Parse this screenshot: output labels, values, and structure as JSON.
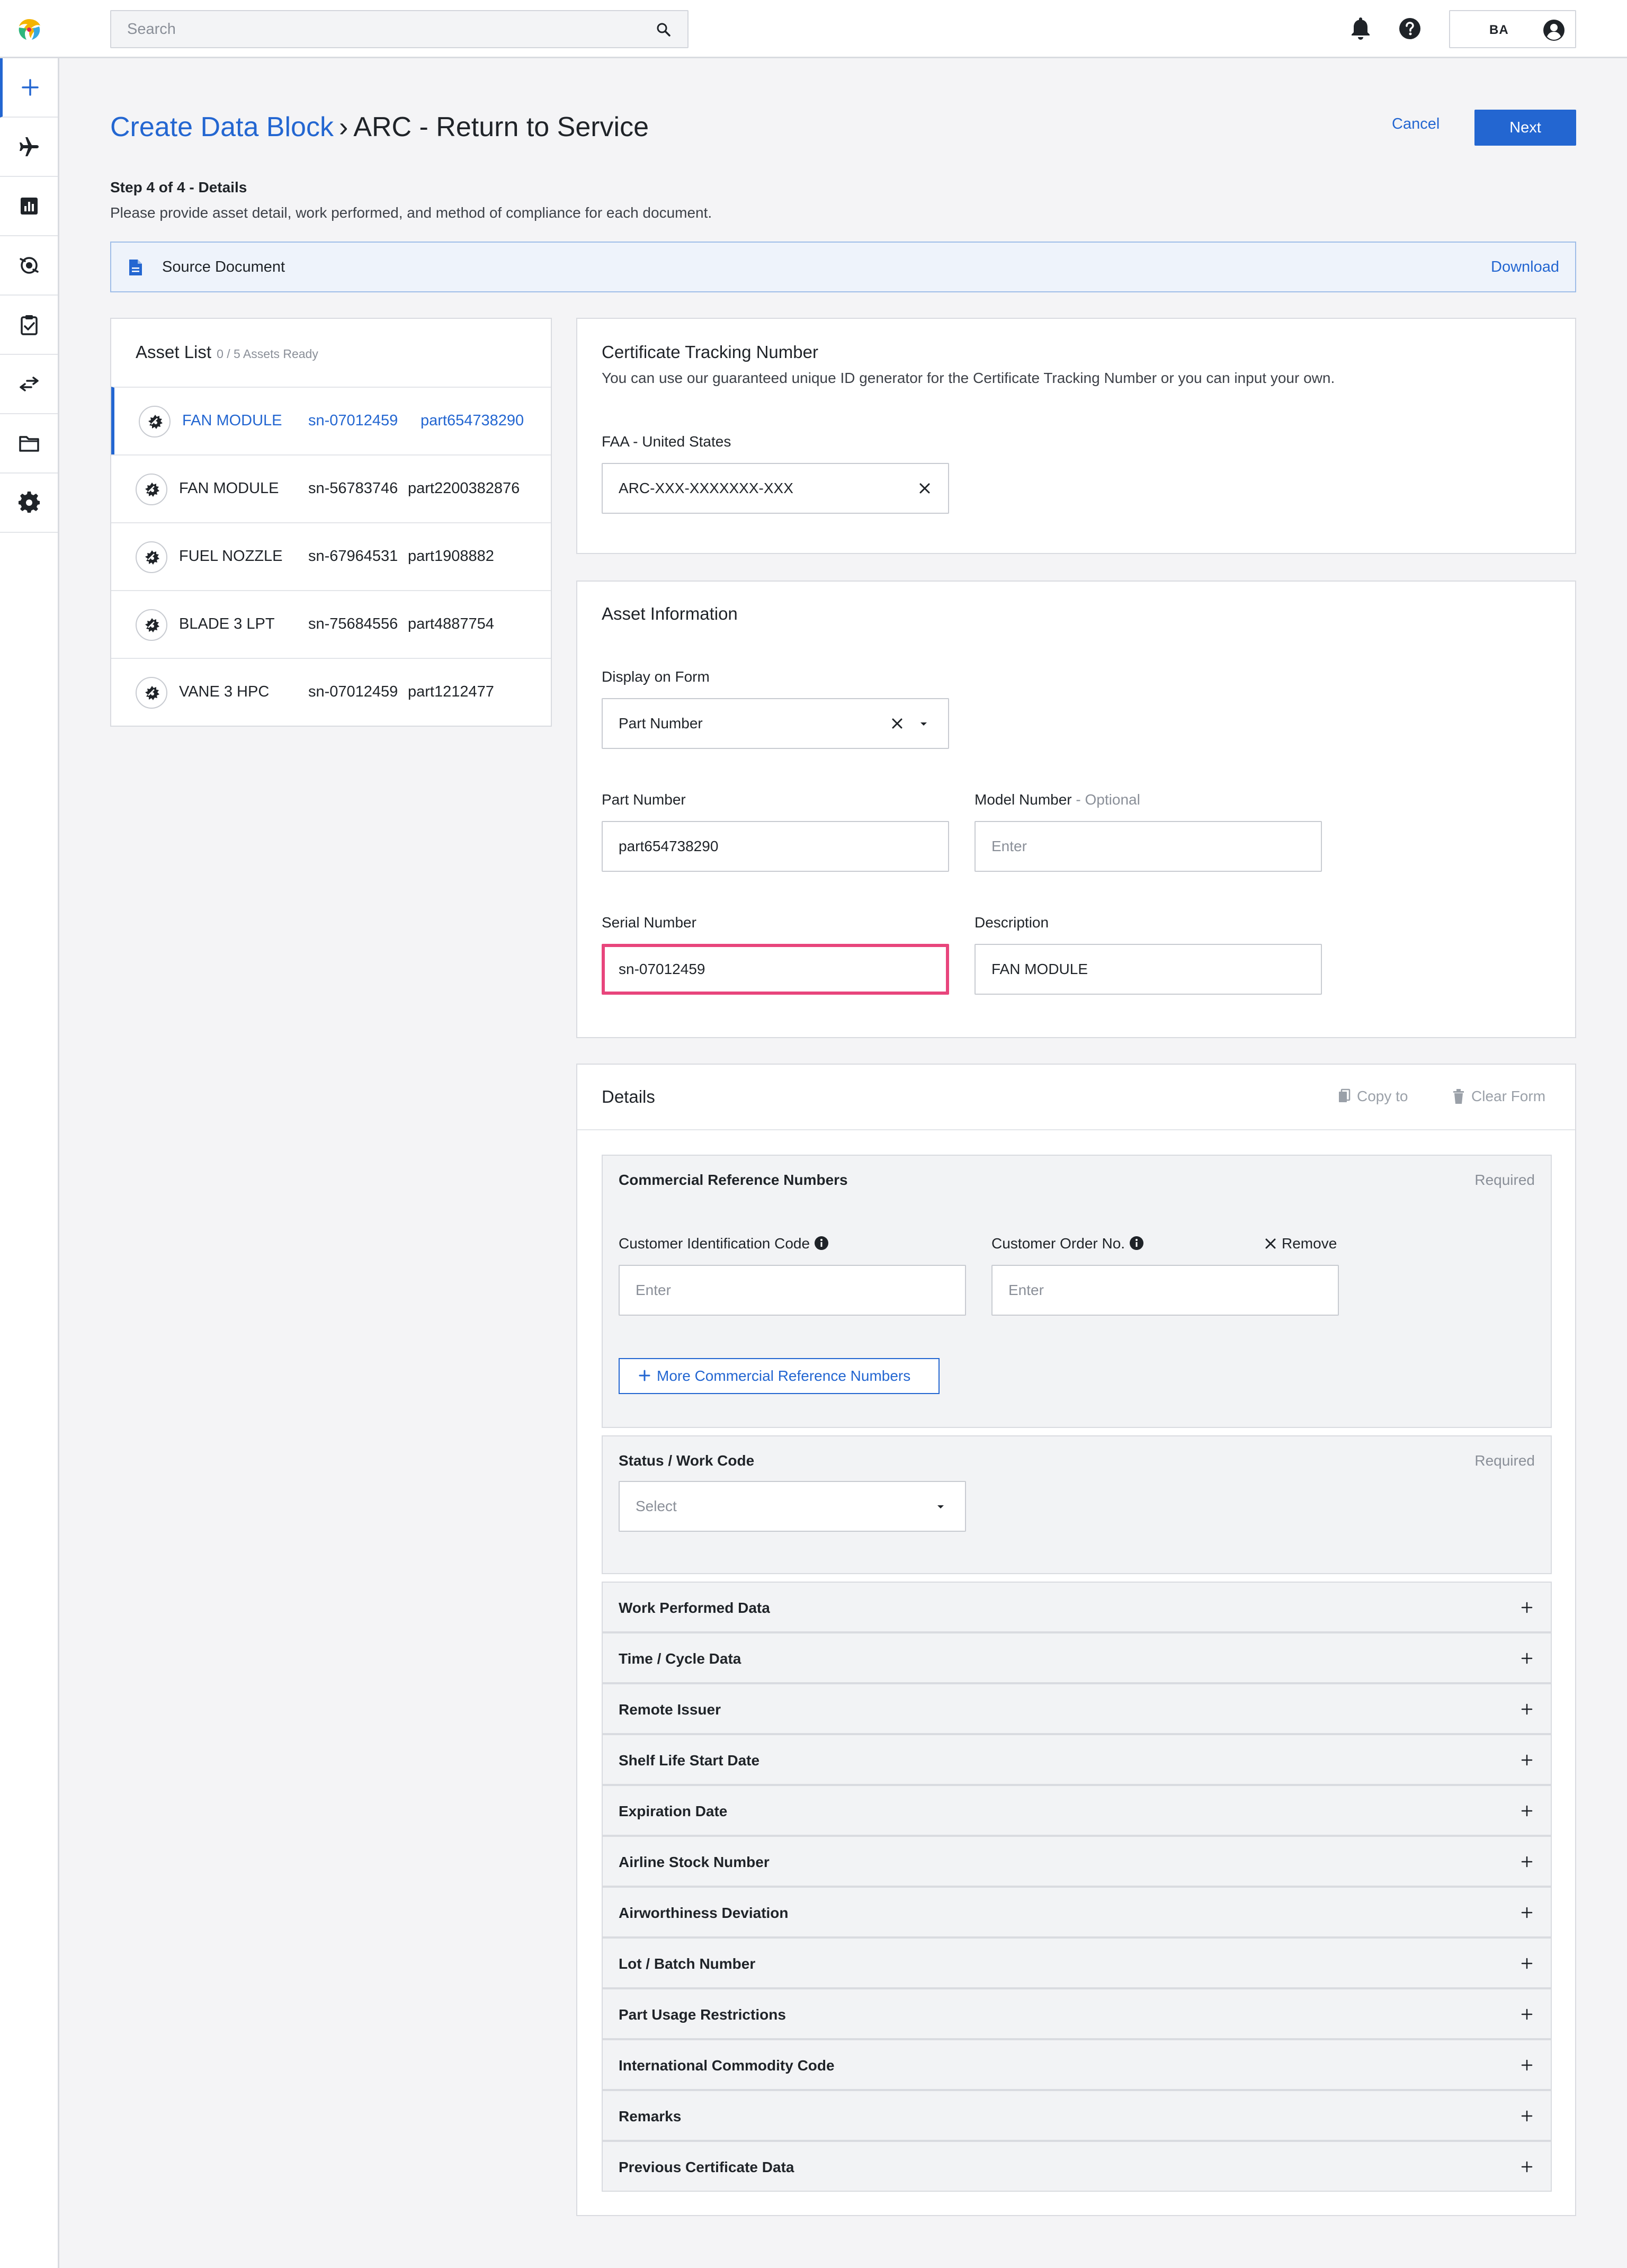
{
  "topbar": {
    "search_placeholder": "Search",
    "user_initials": "BA"
  },
  "rail": {
    "items": [
      "create",
      "aircraft",
      "reports",
      "tracking",
      "tasks",
      "transfers",
      "folders",
      "settings"
    ]
  },
  "header": {
    "breadcrumb_link": "Create Data Block",
    "breadcrumb_sep": "›",
    "breadcrumb_current": "ARC - Return to Service",
    "cancel_label": "Cancel",
    "next_label": "Next",
    "step": "Step 4 of 4 - Details",
    "step_desc": "Please provide asset detail, work performed, and method of compliance for each document."
  },
  "source_doc": {
    "label": "Source Document",
    "download": "Download"
  },
  "asset_list": {
    "title": "Asset List",
    "ready": "0 / 5 Assets Ready",
    "items": [
      {
        "name": "FAN MODULE",
        "serial": "sn-07012459",
        "part": "part654738290",
        "active": true
      },
      {
        "name": "FAN MODULE",
        "serial": "sn-56783746",
        "part": "part2200382876"
      },
      {
        "name": "FUEL NOZZLE",
        "serial": "sn-67964531",
        "part": "part1908882"
      },
      {
        "name": "BLADE 3 LPT",
        "serial": "sn-75684556",
        "part": "part4887754"
      },
      {
        "name": "VANE 3 HPC",
        "serial": "sn-07012459",
        "part": "part1212477"
      }
    ]
  },
  "ctn": {
    "title": "Certificate Tracking Number",
    "desc": "You can use our guaranteed unique ID generator for the Certificate Tracking Number or you can input your own.",
    "field_label": "FAA - United States",
    "value": "ARC-XXX-XXXXXXX-XXX"
  },
  "asset_info": {
    "title": "Asset Information",
    "display_label": "Display on Form",
    "display_value": "Part Number",
    "part_label": "Part Number",
    "part_value": "part654738290",
    "model_label": "Model Number",
    "model_optional": " - Optional",
    "model_placeholder": "Enter",
    "serial_label": "Serial Number",
    "serial_value": "sn-07012459",
    "desc_label": "Description",
    "desc_value": "FAN MODULE"
  },
  "details": {
    "title": "Details",
    "copy_to": "Copy to",
    "clear_form": "Clear Form",
    "crn": {
      "title": "Commercial Reference Numbers",
      "required": "Required",
      "cust_id_label": "Customer Identification Code",
      "cust_order_label": "Customer Order No.",
      "remove": "Remove",
      "placeholder": "Enter",
      "more": "More Commercial Reference Numbers"
    },
    "status": {
      "title": "Status / Work Code",
      "required": "Required",
      "placeholder": "Select"
    },
    "accordions": [
      "Work Performed Data",
      "Time / Cycle Data",
      "Remote Issuer",
      "Shelf Life Start Date",
      "Expiration Date",
      "Airline Stock Number",
      "Airworthiness Deviation",
      "Lot / Batch Number",
      "Part Usage Restrictions",
      "International Commodity Code",
      "Remarks",
      "Previous Certificate Data"
    ]
  },
  "colors": {
    "accent": "#2366d1",
    "focus": "#e8457c",
    "muted": "#8a8f98"
  }
}
